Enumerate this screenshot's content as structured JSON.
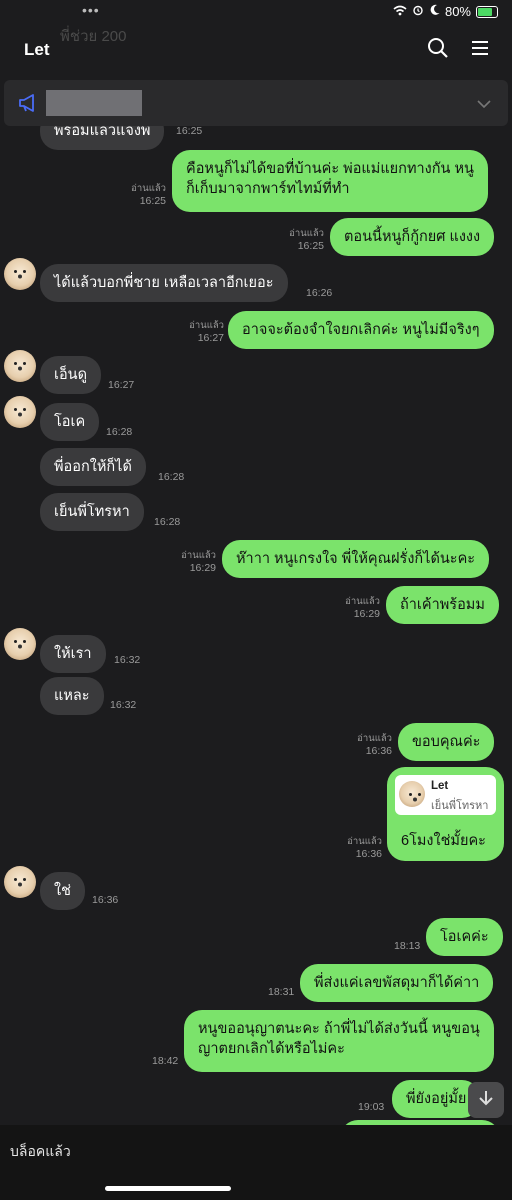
{
  "status_bar": {
    "battery": "80%",
    "battery_level": 0.8
  },
  "header": {
    "title": "Let",
    "behind_title_text": "พี่ช่วย 200",
    "search_icon": "search-icon",
    "menu_icon": "menu-icon"
  },
  "announcement": {
    "icon": "megaphone-icon",
    "chevron": "chevron-down-icon"
  },
  "messages": [
    {
      "side": "in",
      "text": "พร้อมแล้วแจ้งพี่",
      "time": "16:25"
    },
    {
      "side": "out",
      "line1": "คือหนูก็ไม่ได้ขอที่บ้านค่ะ พ่อแม่แยกทางกัน หนู",
      "line2": "ก็เก็บมาจากพาร์ทไทม์ที่ทำ",
      "read": "อ่านแล้ว",
      "time": "16:25"
    },
    {
      "side": "out",
      "text": "ตอนนี้หนูก็กู้กยศ แงงง",
      "read": "อ่านแล้ว",
      "time": "16:25"
    },
    {
      "side": "in",
      "text": "ได้แล้วบอกพี่ชาย เหลือเวลาอีกเยอะ",
      "time": "16:26"
    },
    {
      "side": "out",
      "text": "อาจจะต้องจำใจยกเลิกค่ะ หนูไม่มีจริงๆ",
      "read": "อ่านแล้ว",
      "time": "16:27"
    },
    {
      "side": "in",
      "text": "เอ็นดู",
      "time": "16:27"
    },
    {
      "side": "in",
      "text": "โอเค",
      "time": "16:28"
    },
    {
      "side": "in",
      "text": "พี่ออกให้ก็ได้",
      "time": "16:28"
    },
    {
      "side": "in",
      "text": "เย็นพี่โทรหา",
      "time": "16:28"
    },
    {
      "side": "out",
      "text": "ห๊าาา หนูเกรงใจ พี่ให้คุณฝรั่งก็ได้นะคะ",
      "read": "อ่านแล้ว",
      "time": "16:29"
    },
    {
      "side": "out",
      "text": "ถ้าเค้าพร้อมม",
      "read": "อ่านแล้ว",
      "time": "16:29"
    },
    {
      "side": "in",
      "text": "ให้เรา",
      "time": "16:32"
    },
    {
      "side": "in",
      "text": "แหละ",
      "time": "16:32"
    },
    {
      "side": "out",
      "text": "ขอบคุณค่ะ",
      "read": "อ่านแล้ว",
      "time": "16:36"
    },
    {
      "side": "out",
      "reply_name": "Let",
      "reply_text": "เย็นพี่โทรหา",
      "text": "6โมงใช่มั้ยคะ",
      "read": "อ่านแล้ว",
      "time": "16:36"
    },
    {
      "side": "in",
      "text": "ใช่",
      "time": "16:36"
    },
    {
      "side": "out",
      "text": "โอเคค่ะ",
      "time": "18:13"
    },
    {
      "side": "out",
      "text": "พี่ส่งแค่เลขพัสดุมาก็ได้ค่าา",
      "time": "18:31"
    },
    {
      "side": "out",
      "line1": "หนูขออนุญาตนะคะ ถ้าพี่ไม่ได้ส่งวันนี้ หนูขอนุ",
      "line2": "ญาตยกเลิกได้หรือไม่คะ",
      "time": "18:42"
    },
    {
      "side": "out",
      "text": "พี่ยังอยู่มั้ย",
      "time": "19:03"
    }
  ],
  "footer": {
    "blocked_label": "บล็อคแล้ว"
  },
  "scroll_button_icon": "arrow-down-icon",
  "colors": {
    "background": "#1c1c1e",
    "incoming_bubble": "#3a3a3c",
    "outgoing_bubble": "#7be36b",
    "accent": "#4a6cf7"
  }
}
